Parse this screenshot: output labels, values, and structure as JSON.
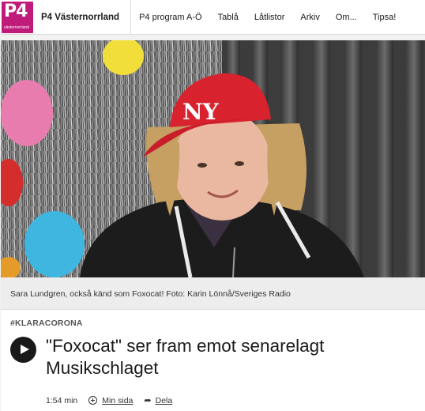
{
  "colors": {
    "brand": "#c01a7a",
    "cap": "#d8232f",
    "hoodie": "#1c1c1c"
  },
  "header": {
    "logo_mark": "P4",
    "logo_sub": "västernorrland",
    "station": "P4 Västernorrland",
    "nav": [
      "P4 program A-Ö",
      "Tablå",
      "Låtlistor",
      "Arkiv",
      "Om...",
      "Tipsa!"
    ]
  },
  "hero": {
    "cap_logo": "NY",
    "caption": "Sara Lundgren, också känd som Foxocat! Foto: Karin Lönnå/Sveriges Radio"
  },
  "article": {
    "tag": "#KLARACORONA",
    "title": "\"Foxocat\" ser fram emot senarelagt Musikschlaget",
    "duration": "1:54 min",
    "my_page": "Min sida",
    "share": "Dela"
  }
}
